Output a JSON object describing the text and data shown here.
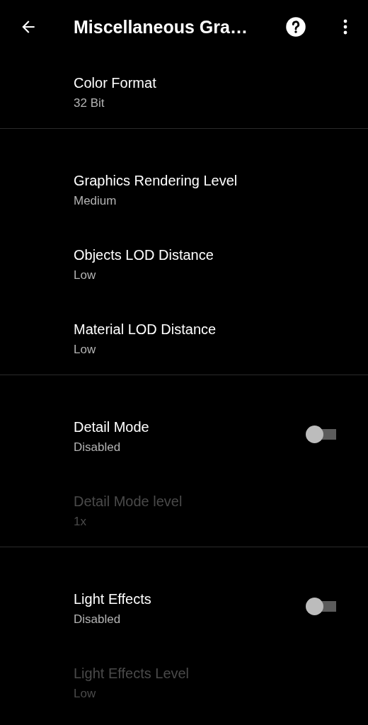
{
  "app_bar": {
    "title": "Miscellaneous Gra…"
  },
  "sections": [
    {
      "items": [
        {
          "kind": "text",
          "title": "Color Format",
          "summary": "32 Bit",
          "disabled": false
        }
      ]
    },
    {
      "items": [
        {
          "kind": "text",
          "title": "Graphics Rendering Level",
          "summary": "Medium",
          "disabled": false
        },
        {
          "kind": "text",
          "title": "Objects LOD Distance",
          "summary": "Low",
          "disabled": false
        },
        {
          "kind": "text",
          "title": "Material LOD Distance",
          "summary": "Low",
          "disabled": false
        }
      ]
    },
    {
      "items": [
        {
          "kind": "switch",
          "title": "Detail Mode",
          "summary": "Disabled",
          "disabled": false,
          "on": false
        },
        {
          "kind": "text",
          "title": "Detail Mode level",
          "summary": "1x",
          "disabled": true
        }
      ]
    },
    {
      "items": [
        {
          "kind": "switch",
          "title": "Light Effects",
          "summary": "Disabled",
          "disabled": false,
          "on": false
        },
        {
          "kind": "text",
          "title": "Light Effects Level",
          "summary": "Low",
          "disabled": true
        }
      ]
    }
  ]
}
